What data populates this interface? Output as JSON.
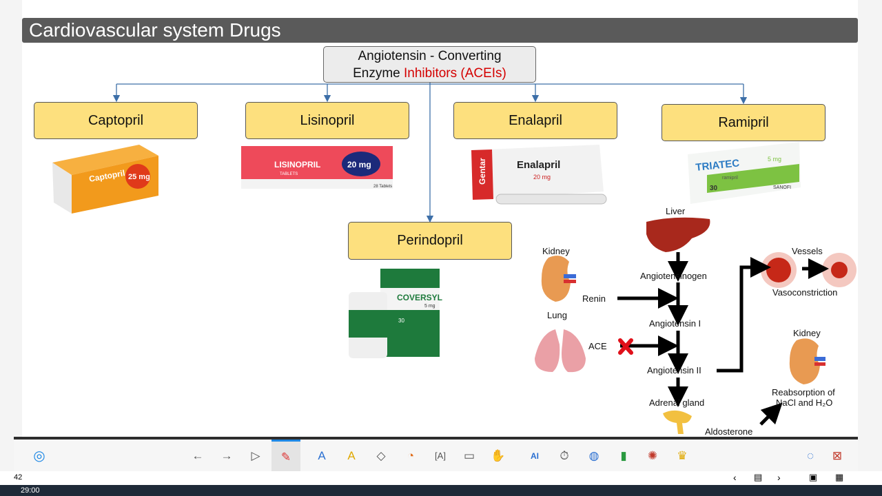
{
  "slide": {
    "title": "Cardiovascular system Drugs",
    "ace_box": {
      "line1": "Angiotensin - Converting",
      "line2_prefix": "Enzyme ",
      "line2_highlight": "Inhibitors (ACEIs)"
    },
    "drugs": [
      {
        "label": "Captopril",
        "pack": "Captopril",
        "pack_dose": "25 mg"
      },
      {
        "label": "Lisinopril",
        "pack": "LISINOPRIL",
        "pack_dose": "20 mg",
        "pack_sub": "TABLETS",
        "pack_count": "28 Tablets"
      },
      {
        "label": "Enalapril",
        "pack": "Enalapril",
        "pack_dose": "20 mg",
        "pack_brand": "Gentar"
      },
      {
        "label": "Ramipril",
        "pack": "TRIATEC",
        "pack_dose": "5 mg",
        "pack_sub": "ramipril",
        "pack_count": "30",
        "pack_brand": "SANOFI"
      },
      {
        "label": "Perindopril",
        "pack": "COVERSYL",
        "pack_dose": "5 mg",
        "pack_count": "30"
      }
    ],
    "pathway": {
      "liver": "Liver",
      "angiotensinogen": "Angiotensinogen",
      "kidney_left": "Kidney",
      "renin": "Renin",
      "angiotensin1": "Angiotensin I",
      "lung": "Lung",
      "ace": "ACE",
      "angiotensin2": "Angiotensin II",
      "adrenal": "Adrenal gland",
      "aldosterone": "Aldosterone",
      "vessels": "Vessels",
      "vasoconstriction": "Vasoconstriction",
      "kidney_right": "Kidney",
      "reabsorption_line1": "Reabsorption of",
      "reabsorption_line2": "NaCl and H₂O"
    }
  },
  "toolbar": {
    "icons": [
      "app-logo-icon",
      "back-arrow-icon",
      "forward-arrow-icon",
      "pointer-icon",
      "pen-icon",
      "highlighter-icon",
      "marker-icon",
      "eraser-icon",
      "shape-icon",
      "text-icon",
      "screen-icon",
      "hand-icon",
      "ai-icon",
      "timer-icon",
      "globe-icon",
      "chart-icon",
      "wheel-icon",
      "trophy-icon",
      "eye-off-icon",
      "exit-icon"
    ]
  },
  "status": {
    "page": "42",
    "time": "29:00"
  },
  "colors": {
    "box_fill": "#fde07e",
    "title_bar": "#5a5a5a",
    "highlight": "#d40000",
    "connector": "#3d6fa8"
  }
}
